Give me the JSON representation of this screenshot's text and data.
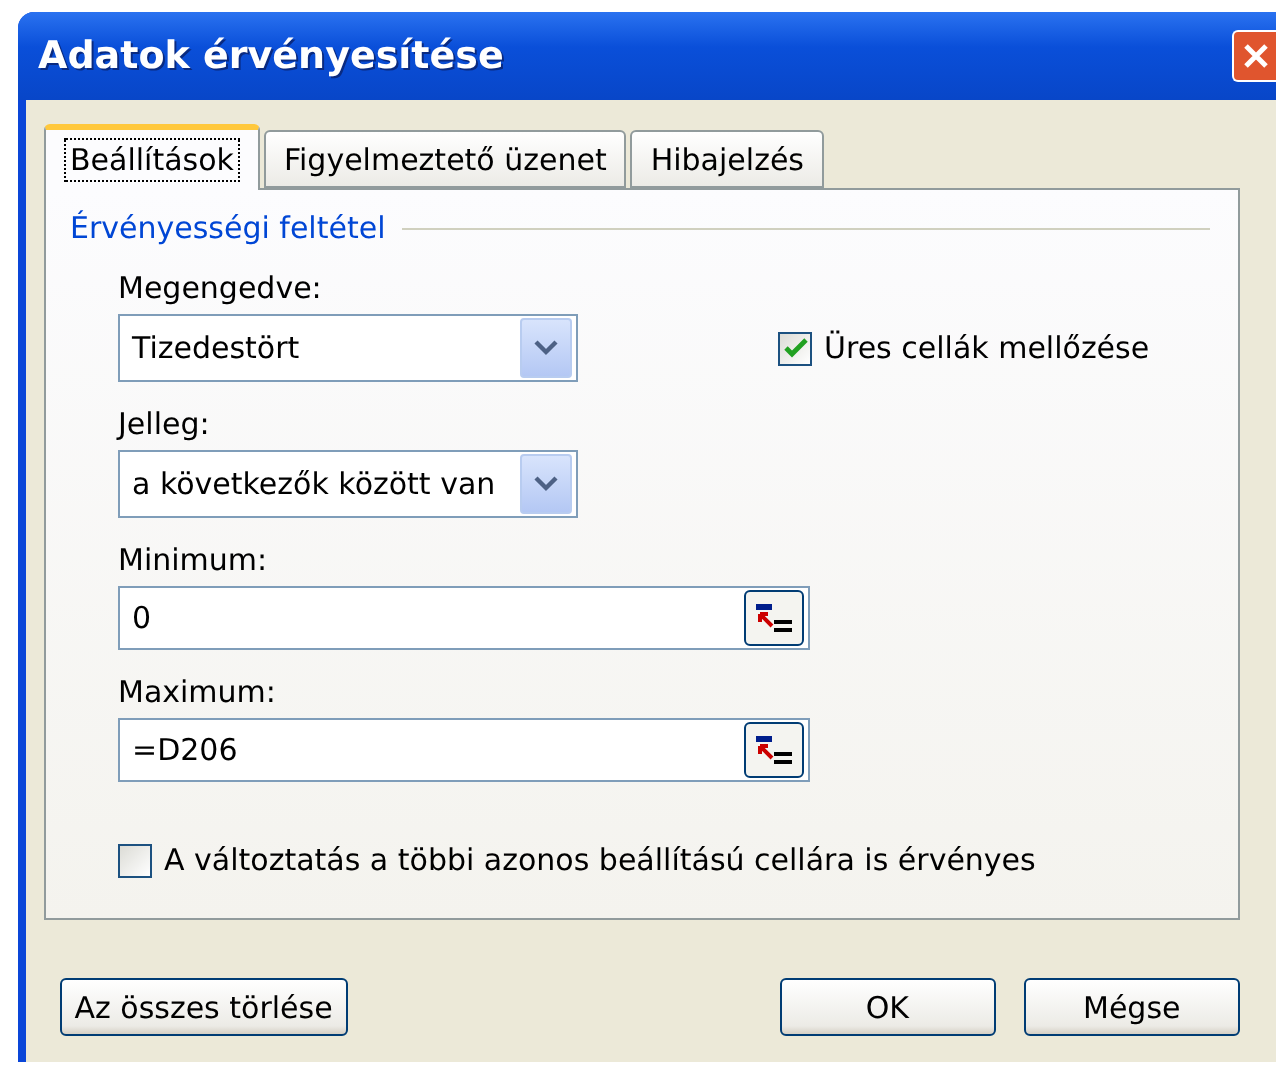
{
  "window": {
    "title": "Adatok érvényesítése"
  },
  "tabs": [
    {
      "label": "Beállítások",
      "selected": true
    },
    {
      "label": "Figyelmeztető üzenet",
      "selected": false
    },
    {
      "label": "Hibajelzés",
      "selected": false
    }
  ],
  "group": {
    "title": "Érvényességi feltétel"
  },
  "allow": {
    "label": "Megengedve:",
    "value": "Tizedestört"
  },
  "ignore_blank": {
    "label": "Üres cellák mellőzése",
    "checked": true
  },
  "data": {
    "label": "Jelleg:",
    "value": "a következők között van"
  },
  "minimum": {
    "label": "Minimum:",
    "value": "0"
  },
  "maximum": {
    "label": "Maximum:",
    "value": "=D206"
  },
  "apply_all": {
    "label": "A változtatás a többi azonos beállítású cellára is érvényes",
    "checked": false
  },
  "buttons": [
    {
      "label": "Az összes törlése",
      "kind": "left"
    },
    {
      "label": "OK",
      "kind": "right"
    },
    {
      "label": "Mégse",
      "kind": "right"
    }
  ]
}
